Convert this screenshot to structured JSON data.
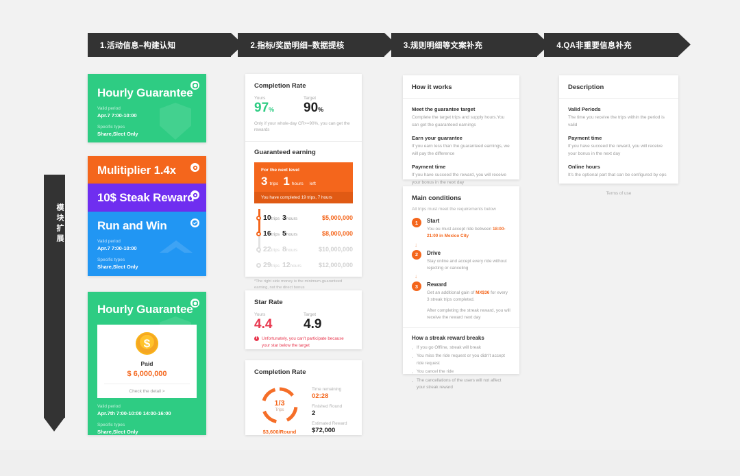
{
  "steps": [
    {
      "label": "1.活动信息–构建认知"
    },
    {
      "label": "2.指标/奖励明细–数据提核"
    },
    {
      "label": "3.规则明细等文案补充"
    },
    {
      "label": "4.QA非重要信息补充"
    }
  ],
  "rail": {
    "label": "模块扩展"
  },
  "promos": {
    "green_top": {
      "title": "Hourly Guarantee",
      "valid_label": "Valid period",
      "valid_value": "Apr.7  7:00-10:00",
      "types_label": "Specific types",
      "types_value": "Share,Slect Only",
      "color": "#2ecc83"
    },
    "orange": {
      "title": "Mulitiplier 1.4x",
      "color": "#f4661c"
    },
    "purple": {
      "title": "10$ Steak Reward",
      "color": "#6f2ef0"
    },
    "blue": {
      "title": "Run and Win",
      "valid_label": "Valid period",
      "valid_value": "Apr.7  7:00-10:00",
      "types_label": "Specific types",
      "types_value": "Share,Slect Only",
      "color": "#2196f3"
    },
    "green_paid": {
      "title": "Hourly Guarantee",
      "status": "Paid",
      "amount": "$ 6,000,000",
      "detail_link": "Check the detail >",
      "valid_label": "Valid period",
      "valid_value": "Apr.7th    7:00-10:00   14:00-16:00",
      "types_label": "Specific types",
      "types_value": "Share,Slect Only",
      "coin_glyph": "$",
      "color": "#2ecc83"
    }
  },
  "completion_top": {
    "title": "Completion Rate",
    "yours_label": "Yours",
    "yours_value": "97",
    "yours_unit": "%",
    "target_label": "Target",
    "target_value": "90",
    "target_unit": "%",
    "note": "Only if your whole-day CR>=90%, you can get the rewards",
    "guaranteed_title": "Guaranteed earning",
    "next_level": {
      "caption": "For the next level",
      "trips_num": "3",
      "trips_unit": "trips",
      "hours_num": "1",
      "hours_unit": "hours",
      "left": "left",
      "footer": "You have completed 19 trips, 7 hours"
    },
    "tiers": [
      {
        "trips": "10",
        "trips_unit": "trips",
        "hours": "3",
        "hours_unit": "hours",
        "amount": "$5,000,000",
        "reached": true
      },
      {
        "trips": "16",
        "trips_unit": "trips",
        "hours": "5",
        "hours_unit": "hours",
        "amount": "$8,000,000",
        "reached": true
      },
      {
        "trips": "22",
        "trips_unit": "trips",
        "hours": "8",
        "hours_unit": "hours",
        "amount": "$10,000,000",
        "reached": false
      },
      {
        "trips": "29",
        "trips_unit": "trips",
        "hours": "12",
        "hours_unit": "hours",
        "amount": "$12,000,000",
        "reached": false
      }
    ],
    "footnote": "*The right side money is the minimum-guaranteed earning, not the direct bonus"
  },
  "star_rate": {
    "title": "Star Rate",
    "yours_label": "Yours",
    "yours_value": "4.4",
    "target_label": "Target",
    "target_value": "4.9",
    "warning": "Unfortunately, you can't participate because your star below the target",
    "warning_icon": "!"
  },
  "completion_bottom": {
    "title": "Completion Rate",
    "donut_value": "1/3",
    "donut_caption": "Trips",
    "donut_percent": 33,
    "round_rate": "$3,600/Round",
    "stats": [
      {
        "label": "Time remaining",
        "value": "02:28",
        "accent": true
      },
      {
        "label": "Finished Round",
        "value": "2",
        "accent": false
      },
      {
        "label": "Estimated Reward",
        "value": "$72,000",
        "accent": false
      }
    ]
  },
  "how_it_works": {
    "title": "How it works",
    "blocks": [
      {
        "heading": "Meet the guarantee target",
        "body": "Complete the target trips and supply hours.You can get the guaranteed earnings"
      },
      {
        "heading": "Earn your guarantee",
        "body": "If you earn less than the guaranteed earnings, we will pay the difference"
      },
      {
        "heading": "Payment time",
        "body": "If you have succeed the reward, you will receive your bonus in the next day"
      }
    ]
  },
  "main_conditions": {
    "title": "Main conditions",
    "subtitle": "All trips must meet the requirements below",
    "steps": [
      {
        "num": "1",
        "heading": "Start",
        "body_prefix": "You ou must accept ride between ",
        "body_hl": "18:00-21:00 in Mexico City",
        "body_suffix": ""
      },
      {
        "num": "2",
        "heading": "Drive",
        "body_prefix": "Stay online and accept every ride without rejecting or canceling",
        "body_hl": "",
        "body_suffix": ""
      },
      {
        "num": "3",
        "heading": "Reward",
        "body_prefix": "Get an additional gain of ",
        "body_hl": "MX$36",
        "body_suffix": " for every 3 streak trips completed.",
        "body_extra": "After completing the streak reward, you will receive the reward next day"
      }
    ],
    "breaks_title": "How a streak reward breaks",
    "breaks": [
      "If you go Offline, streak will break",
      "You miss the ride request or you didn't accept ride request",
      "You cancel the ride",
      "The cancellations of the users will not affect your streak reward"
    ]
  },
  "description": {
    "title": "Description",
    "blocks": [
      {
        "heading": "Valid Periods",
        "body": "The time you receive the trips within the period is valid"
      },
      {
        "heading": "Payment time",
        "body": "If you have succeed the reward, you will receive your bonus in the next day"
      },
      {
        "heading": "Online hours",
        "body": "It's the optional part that can be configured by ops"
      }
    ],
    "terms": "Terms of use"
  },
  "colors": {
    "accent_orange": "#f4661c",
    "accent_green": "#2ecc83",
    "accent_red": "#e8384f",
    "dark": "#333333",
    "background": "#f2f2f2"
  }
}
